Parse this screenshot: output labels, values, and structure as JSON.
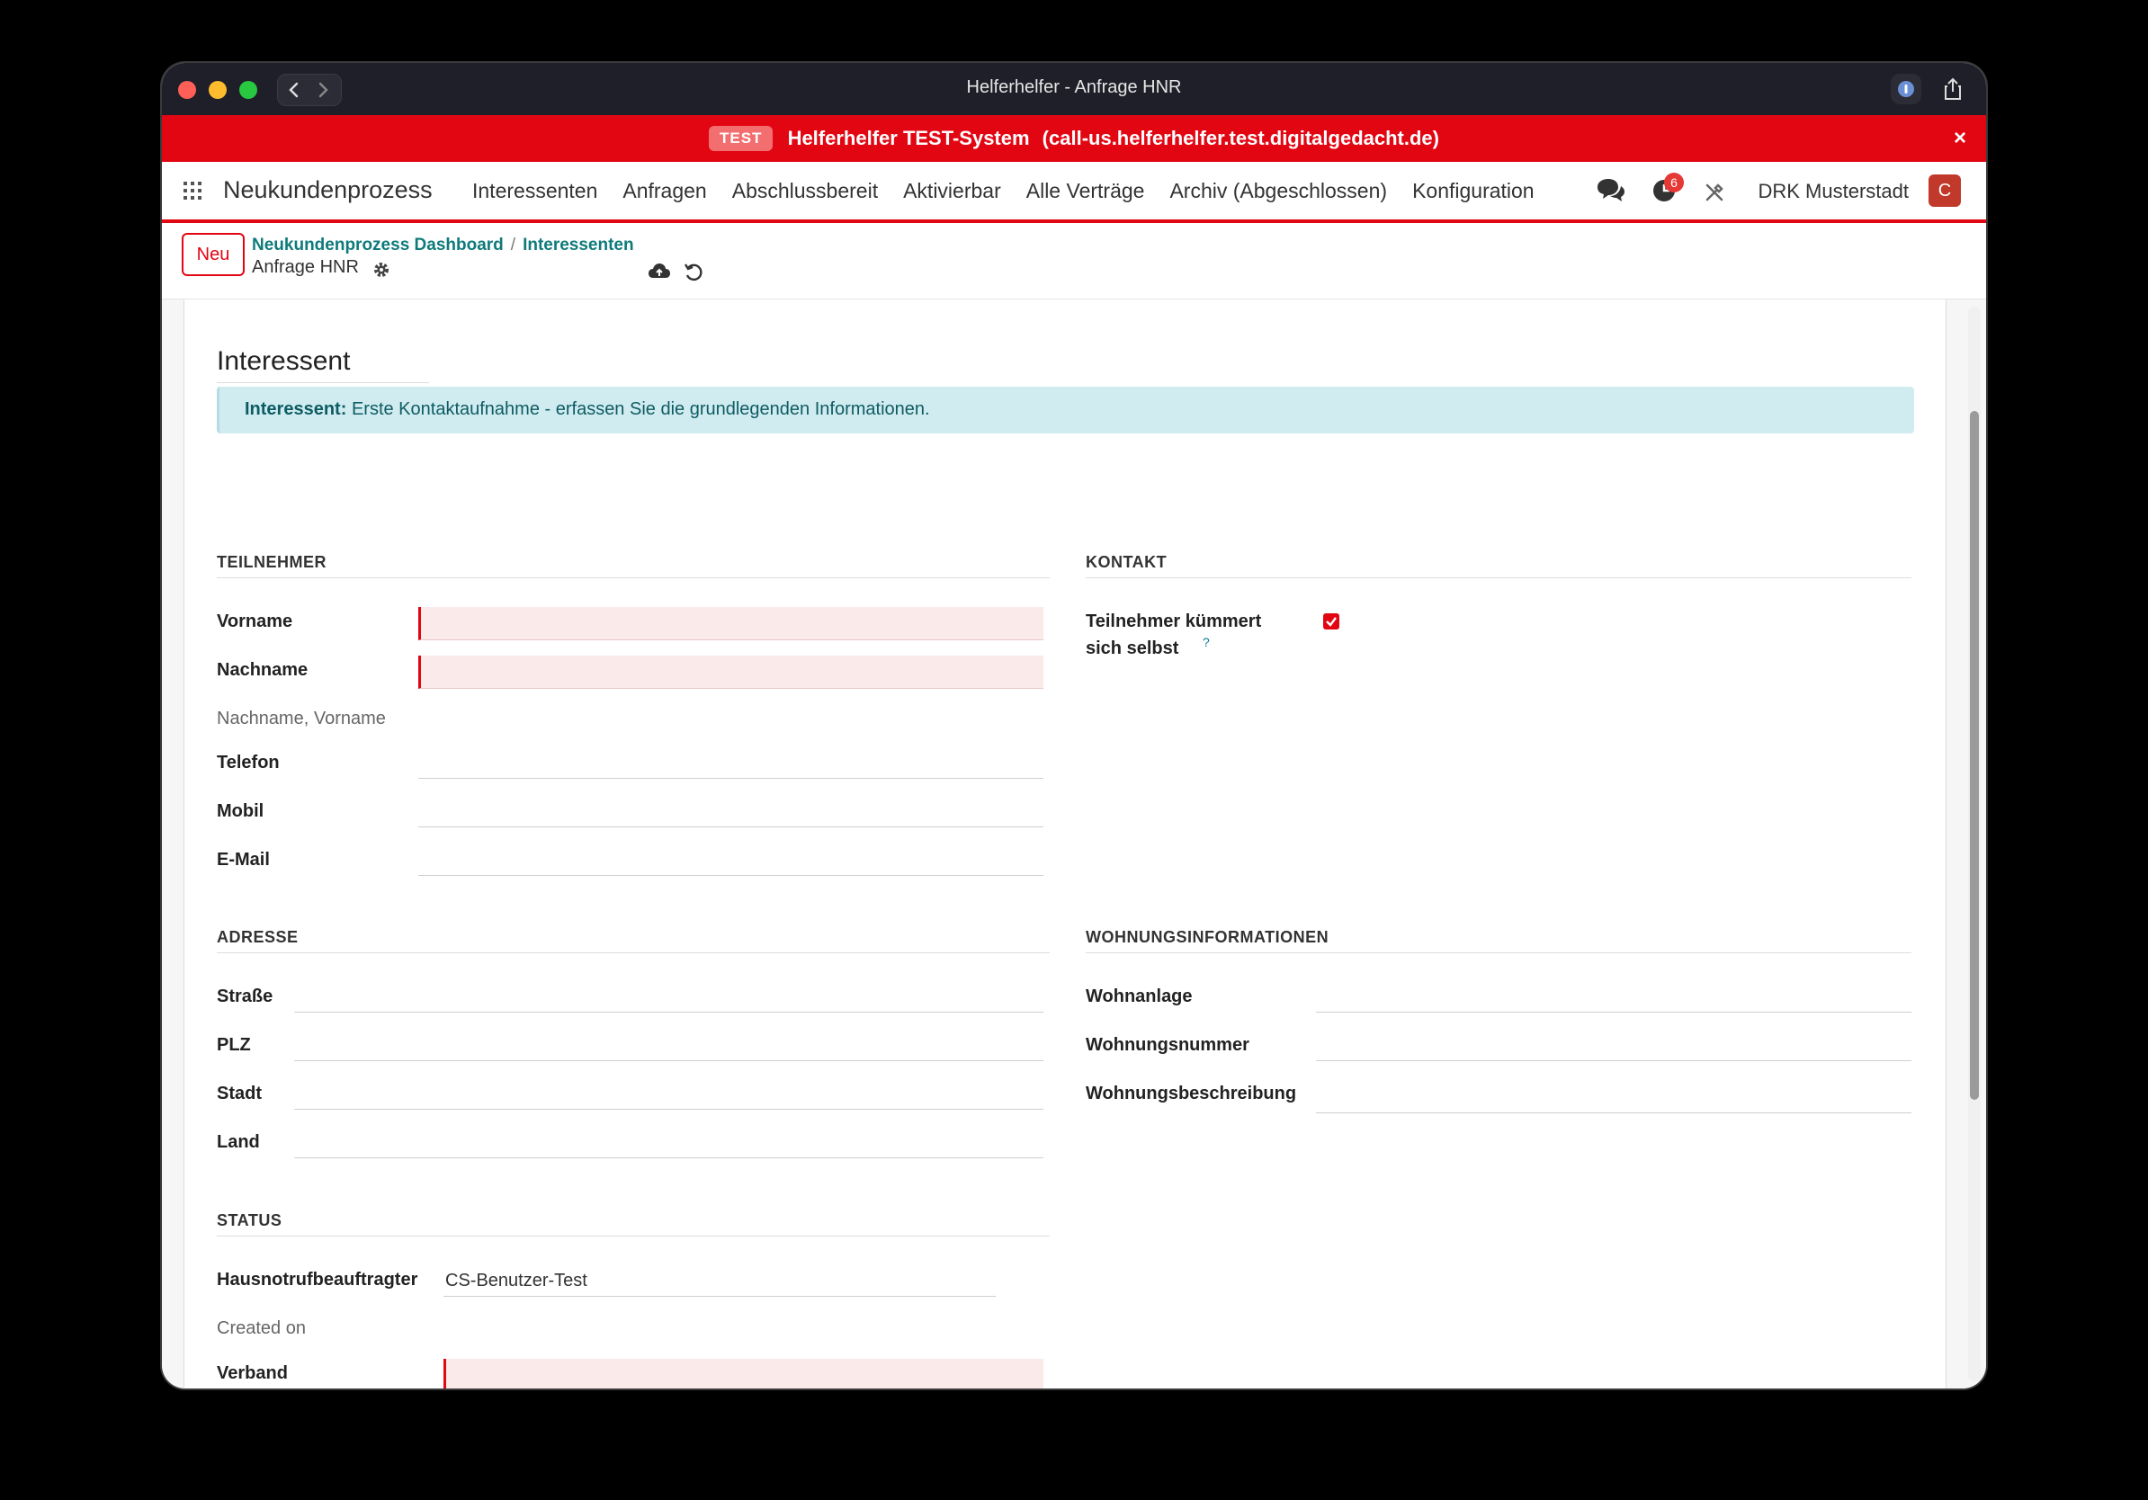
{
  "window": {
    "title": "Helferhelfer - Anfrage HNR"
  },
  "banner": {
    "badge": "TEST",
    "system": "Helferhelfer TEST-System",
    "url": "(call-us.helferhelfer.test.digitalgedacht.de)",
    "close": "×"
  },
  "nav": {
    "brand": "Neukundenprozess",
    "menu": [
      "Interessenten",
      "Anfragen",
      "Abschlussbereit",
      "Aktivierbar",
      "Alle Verträge",
      "Archiv (Abgeschlossen)",
      "Konfiguration"
    ],
    "activity_count": "6",
    "org": "DRK Musterstadt",
    "avatar": "C"
  },
  "control": {
    "new_label": "Neu",
    "breadcrumbs": [
      "Neukundenprozess Dashboard",
      "Interessenten"
    ],
    "breadcrumb_sep": "/",
    "record": "Anfrage HNR"
  },
  "form": {
    "title": "Interessent",
    "alert_bold": "Interessent:",
    "alert_text": "Erste Kontaktaufnahme - erfassen Sie die grundlegenden Informationen.",
    "teilnehmer": {
      "heading": "TEILNEHMER",
      "vorname": "Vorname",
      "nachname": "Nachname",
      "fullname": "Nachname, Vorname",
      "telefon": "Telefon",
      "mobil": "Mobil",
      "email": "E-Mail"
    },
    "kontakt": {
      "heading": "KONTAKT",
      "self_care_1": "Teilnehmer kümmert",
      "self_care_2": "sich selbst",
      "help": "?"
    },
    "adresse": {
      "heading": "ADRESSE",
      "strasse": "Straße",
      "plz": "PLZ",
      "stadt": "Stadt",
      "land": "Land"
    },
    "wohnung": {
      "heading": "WOHNUNGSINFORMATIONEN",
      "anlage": "Wohnanlage",
      "nummer": "Wohnungsnummer",
      "beschreibung": "Wohnungsbeschreibung"
    },
    "status": {
      "heading": "STATUS",
      "beauftragter": "Hausnotrufbeauftragter",
      "beauftragter_value": "CS-Benutzer-Test",
      "created": "Created on",
      "verband": "Verband"
    }
  }
}
